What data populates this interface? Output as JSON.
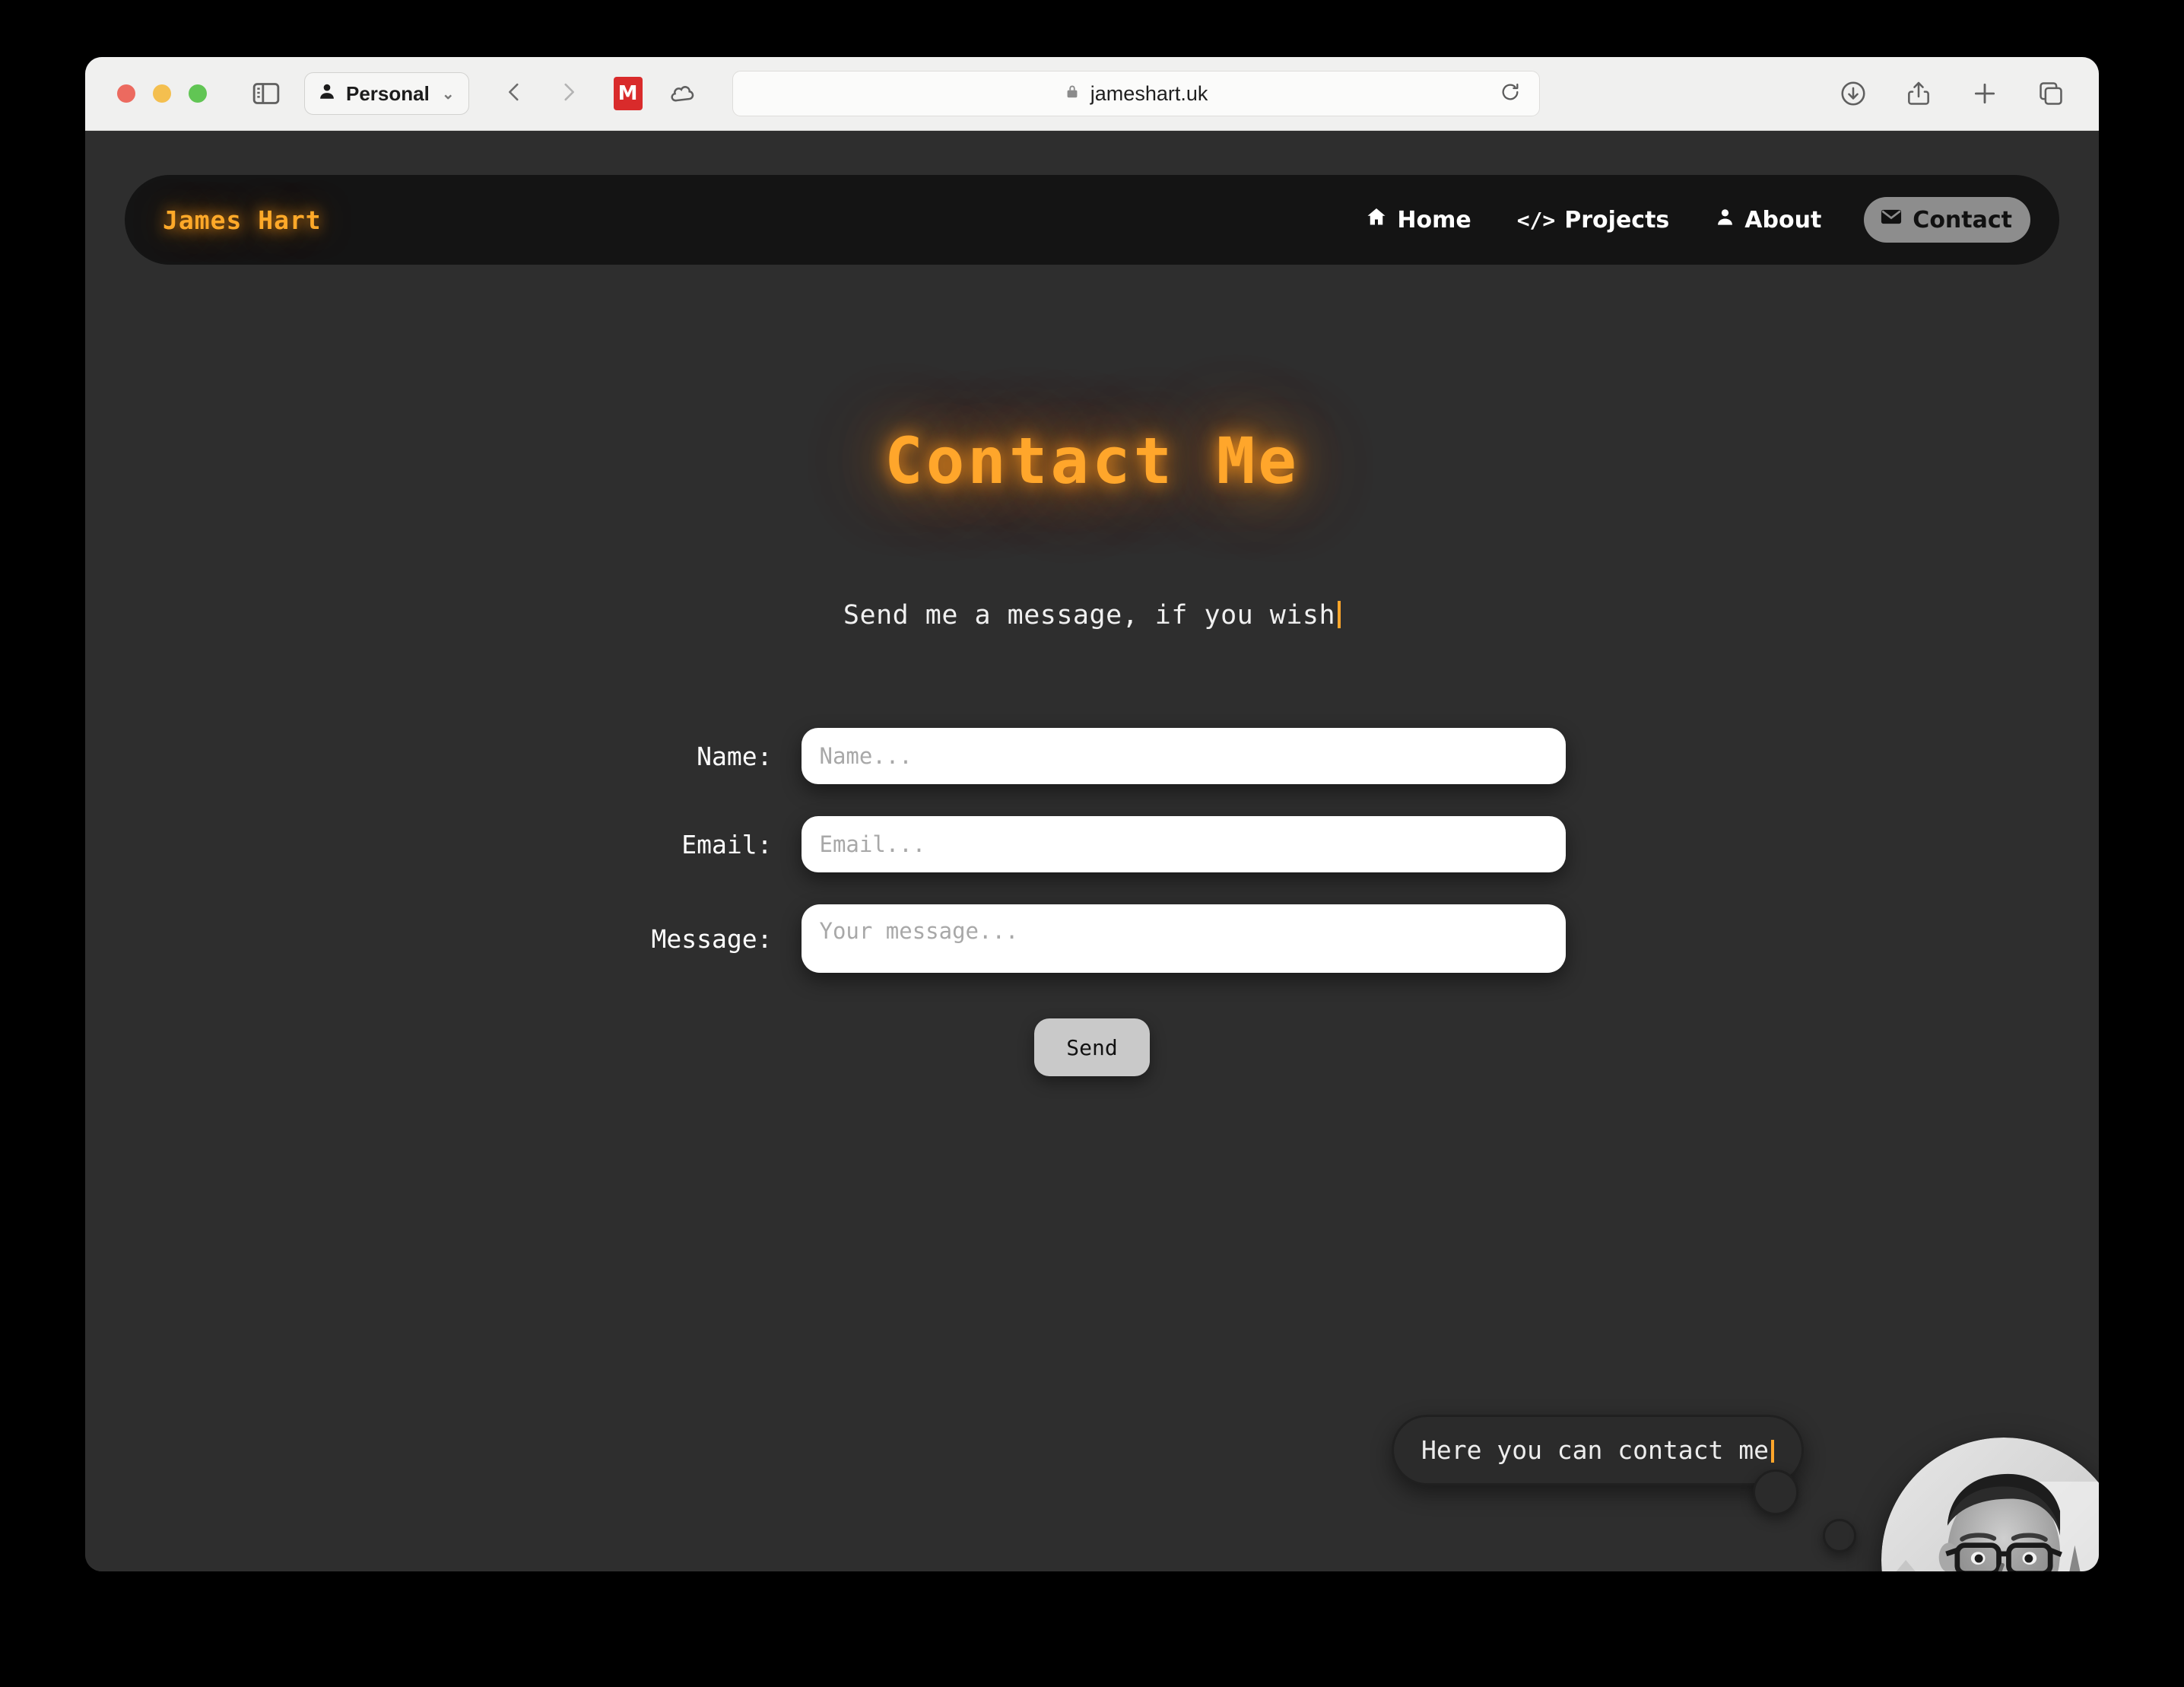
{
  "browser": {
    "profile_label": "Personal",
    "url": "jameshart.uk",
    "icons": {
      "sidebar": "sidebar-toggle-icon",
      "profile": "person-icon",
      "chevron": "chevron-down-icon",
      "back": "back-arrow-icon",
      "forward": "forward-arrow-icon",
      "ext_mendeley": "mendeley-extension-icon",
      "ext_cloud": "cloud-extension-icon",
      "lock": "lock-icon",
      "reload": "reload-icon",
      "downloads": "downloads-icon",
      "share": "share-icon",
      "new_tab": "plus-icon",
      "tab_overview": "tab-overview-icon"
    },
    "traffic_lights": {
      "close": "#ec6a5f",
      "minimize": "#f4bf4f",
      "zoom": "#61c554"
    }
  },
  "site": {
    "brand": "James Hart",
    "accent_color": "#ffa62b",
    "navbar_bg": "#141414",
    "page_bg": "#2e2e2e",
    "nav": [
      {
        "label": "Home",
        "icon": "home-icon",
        "active": false
      },
      {
        "label": "Projects",
        "icon": "code-icon",
        "glyph": "</>",
        "active": false
      },
      {
        "label": "About",
        "icon": "person-icon",
        "active": false
      },
      {
        "label": "Contact",
        "icon": "envelope-icon",
        "active": true
      }
    ]
  },
  "hero": {
    "title": "Contact Me",
    "subtitle": "Send me a message, if you wish"
  },
  "form": {
    "fields": [
      {
        "label": "Name:",
        "value": "",
        "placeholder": "Name..."
      },
      {
        "label": "Email:",
        "value": "",
        "placeholder": "Email..."
      },
      {
        "label": "Message:",
        "value": "",
        "placeholder": "Your message..."
      }
    ],
    "submit_label": "Send"
  },
  "assistant": {
    "bubble_text": "Here you can contact me",
    "close_label": "×",
    "avatar_alt": "portrait-photo"
  }
}
